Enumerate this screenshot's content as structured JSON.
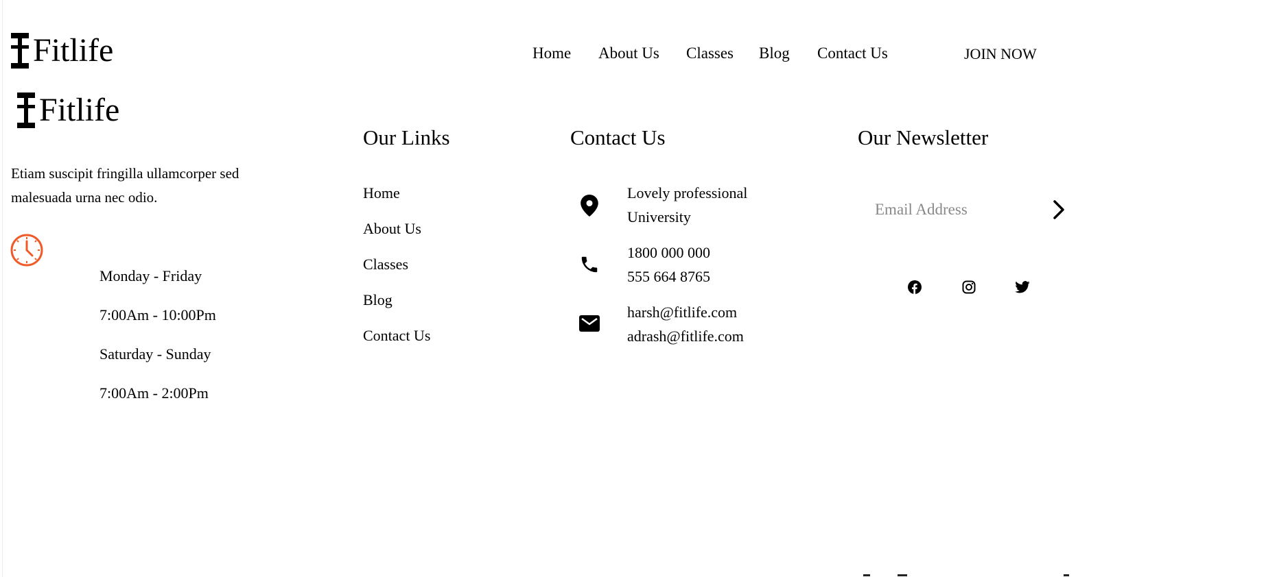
{
  "header": {
    "brand": "Fitlife",
    "nav": [
      "Home",
      "About Us",
      "Classes",
      "Blog",
      "Contact Us"
    ],
    "cta": "JOIN NOW"
  },
  "footer": {
    "brand": "Fitlife",
    "description": "Etiam suscipit fringilla ullamcorper sed malesuada urna nec odio.",
    "hours": [
      "Monday - Friday",
      "7:00Am - 10:00Pm",
      "Saturday - Sunday",
      "7:00Am - 2:00Pm"
    ],
    "links_title": "Our Links",
    "links": [
      "Home",
      "About Us",
      "Classes",
      "Blog",
      "Contact Us"
    ],
    "contact_title": "Contact Us",
    "contact": {
      "address": [
        "Lovely professional",
        "University"
      ],
      "phones": [
        "1800 000 000",
        "555 664 8765"
      ],
      "emails": [
        "harsh@fitlife.com",
        "adrash@fitlife.com"
      ]
    },
    "newsletter_title": "Our Newsletter",
    "email_placeholder": "Email Address",
    "social": [
      "facebook-icon",
      "instagram-icon",
      "twitter-icon"
    ]
  },
  "colors": {
    "accent": "#f05a28",
    "text": "#000000"
  }
}
